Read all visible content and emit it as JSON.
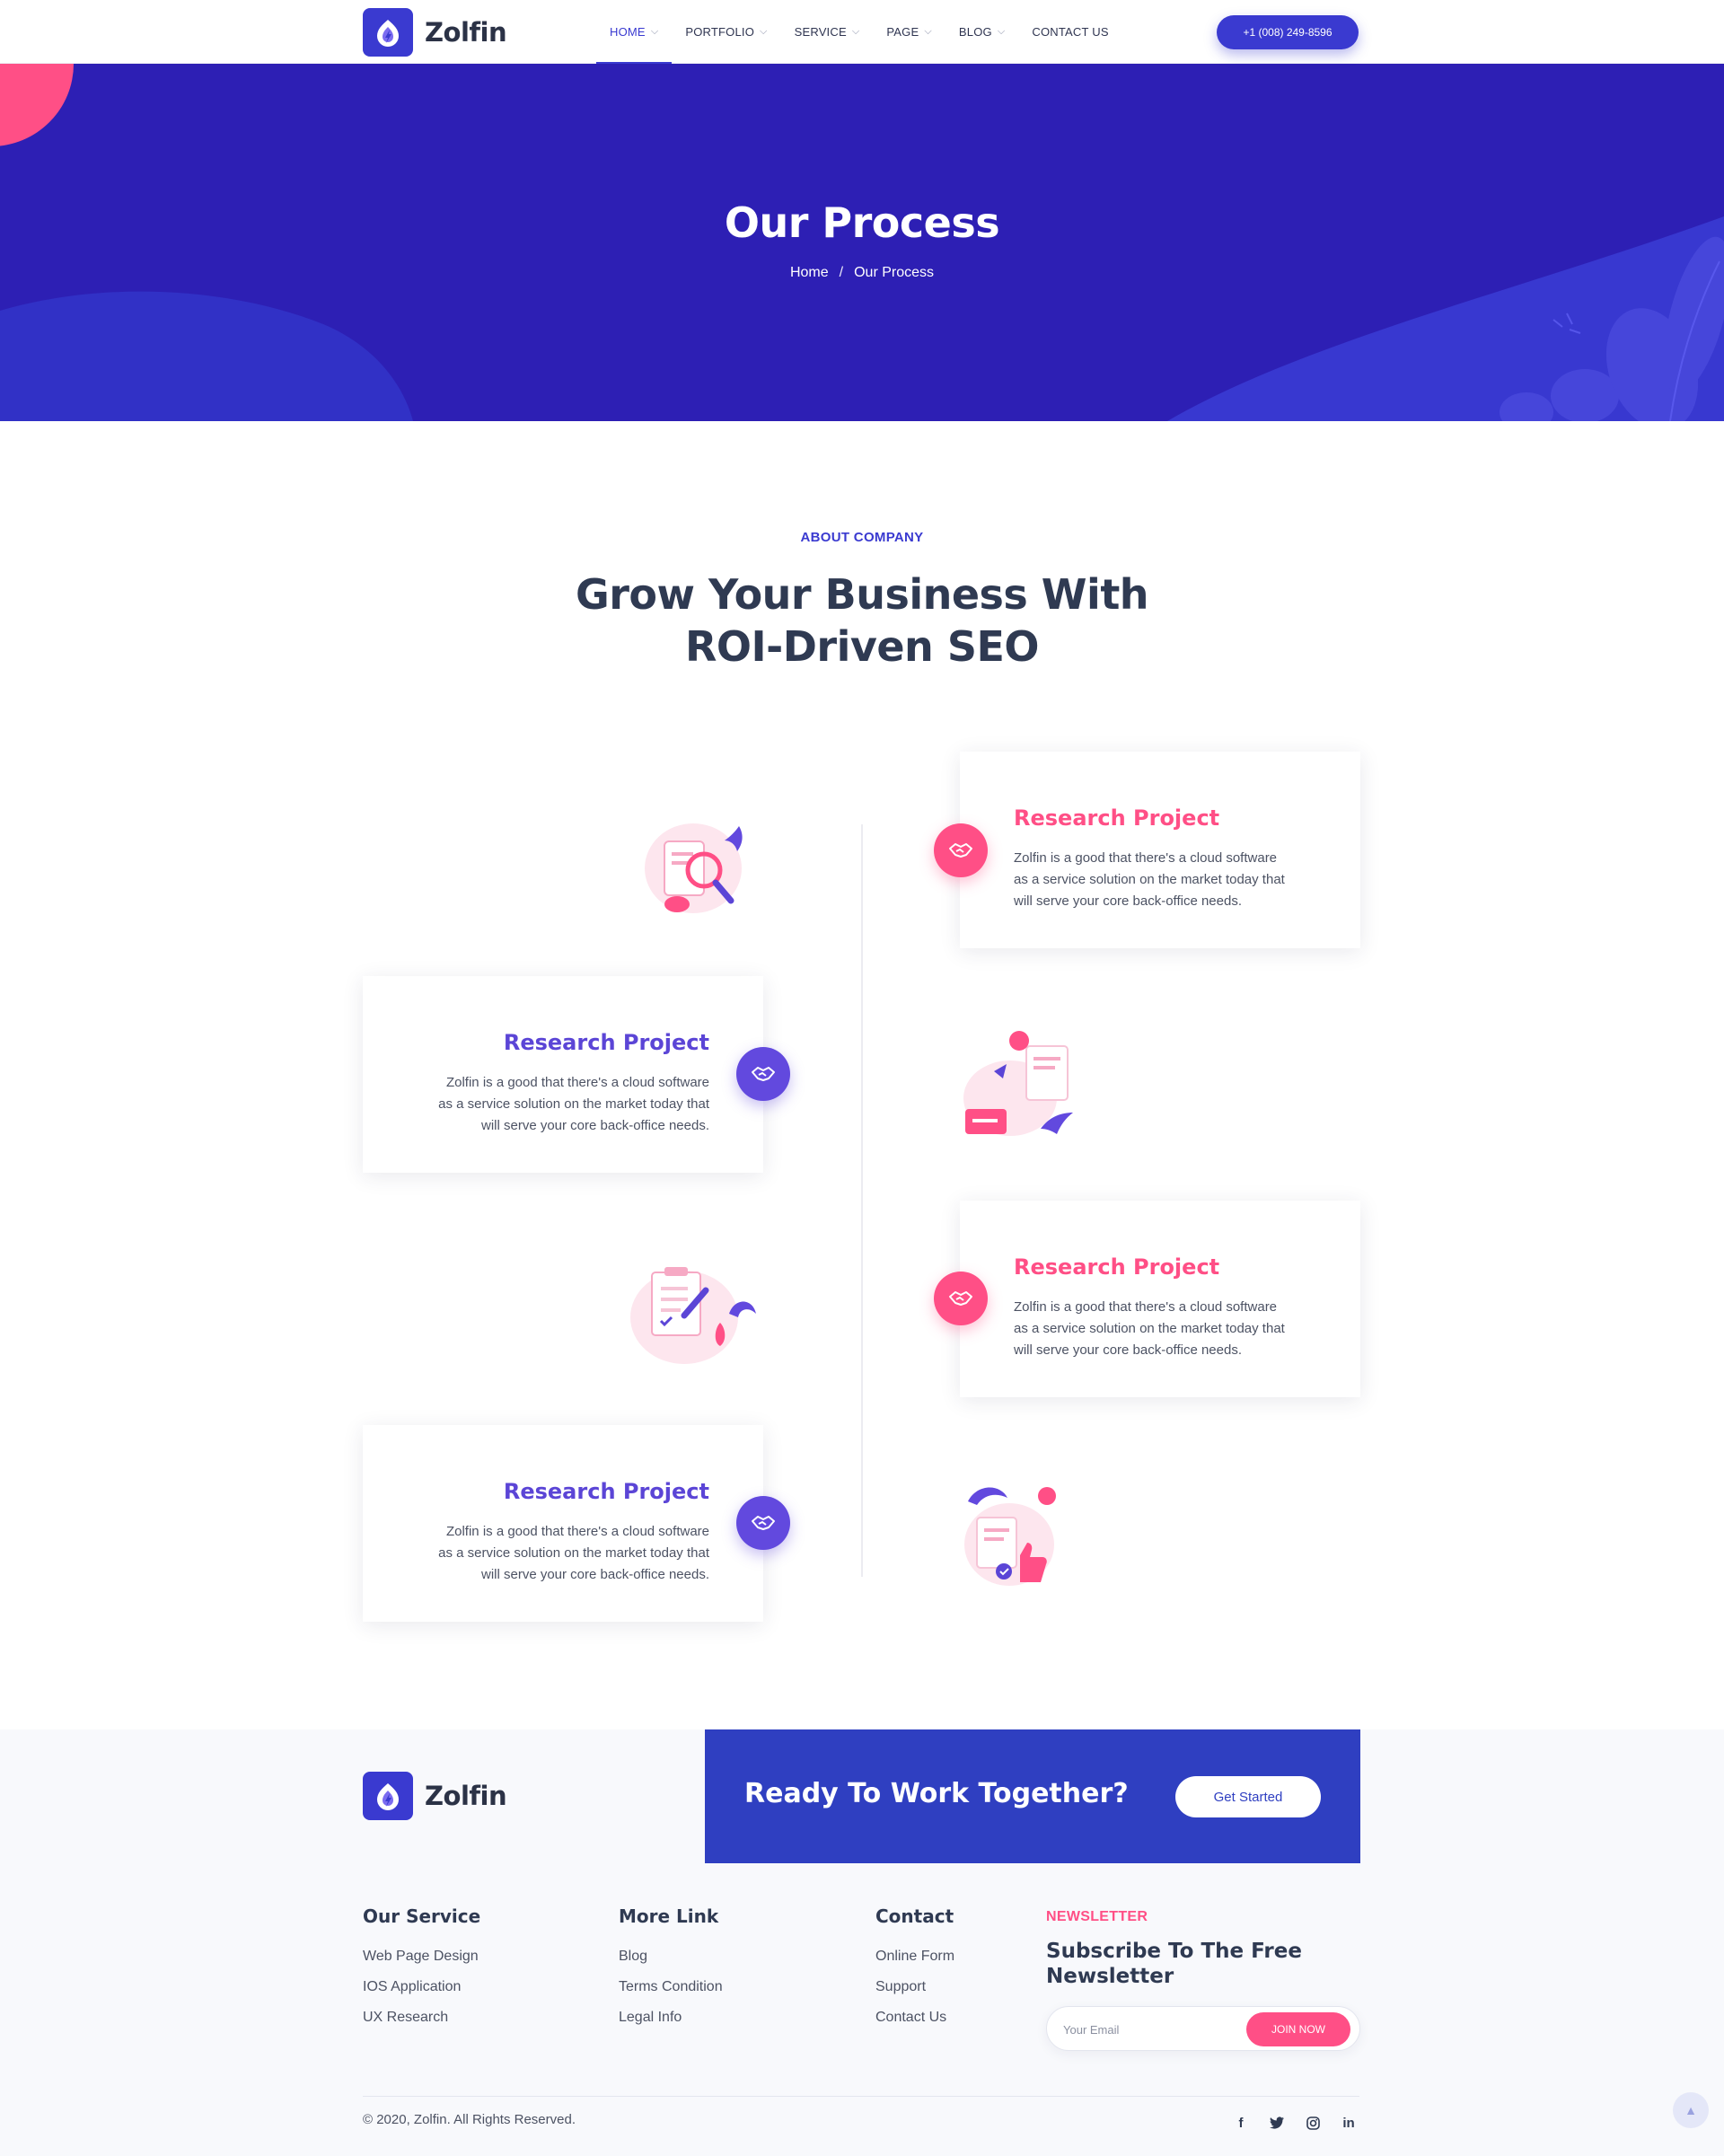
{
  "brand": {
    "name": "Zolfin"
  },
  "nav": {
    "items": [
      {
        "label": "HOME",
        "has_dropdown": true,
        "active": true
      },
      {
        "label": "PORTFOLIO",
        "has_dropdown": true
      },
      {
        "label": "SERVICE",
        "has_dropdown": true
      },
      {
        "label": "PAGE",
        "has_dropdown": true
      },
      {
        "label": "BLOG",
        "has_dropdown": true
      },
      {
        "label": "CONTACT US",
        "has_dropdown": false
      }
    ],
    "phone_button": "+1 (008) 249-8596"
  },
  "banner": {
    "title": "Our Process",
    "breadcrumb": {
      "home": "Home",
      "separator": "/",
      "current": "Our Process"
    }
  },
  "about": {
    "eyebrow": "ABOUT COMPANY",
    "title_line1": "Grow Your Business With",
    "title_line2": "ROI-Driven SEO"
  },
  "process": {
    "steps": [
      {
        "title": "Research Project",
        "line1": "Zolfin is a good that there's a cloud software",
        "line2": "as a service solution on the market today that",
        "line3": "will serve your core back-office needs.",
        "side": "right",
        "icon": "handshake-icon",
        "illustration": "search-document-illustration"
      },
      {
        "title": "Research Project",
        "line1": "Zolfin is a good that there's a cloud software",
        "line2": "as a service solution on the market today that",
        "line3": "will serve your core back-office needs.",
        "side": "left",
        "icon": "handshake-icon",
        "illustration": "chat-messages-illustration"
      },
      {
        "title": "Research Project",
        "line1": "Zolfin is a good that there's a cloud software",
        "line2": "as a service solution on the market today that",
        "line3": "will serve your core back-office needs.",
        "side": "right",
        "icon": "handshake-icon",
        "illustration": "clipboard-checklist-illustration"
      },
      {
        "title": "Research Project",
        "line1": "Zolfin is a good that there's a cloud software",
        "line2": "as a service solution on the market today that",
        "line3": "will serve your core back-office needs.",
        "side": "left",
        "icon": "handshake-icon",
        "illustration": "thumbs-up-document-illustration"
      }
    ]
  },
  "cta": {
    "title": "Ready To Work Together?",
    "button": "Get Started"
  },
  "footer": {
    "columns": [
      {
        "heading": "Our Service",
        "links": [
          "Web Page Design",
          "IOS Application",
          "UX Research"
        ]
      },
      {
        "heading": "More Link",
        "links": [
          "Blog",
          "Terms Condition",
          "Legal Info"
        ]
      },
      {
        "heading": "Contact",
        "links": [
          "Online Form",
          "Support",
          "Contact Us"
        ]
      }
    ],
    "newsletter": {
      "eyebrow": "NEWSLETTER",
      "title": "Subscribe To The Free Newsletter",
      "placeholder": "Your Email",
      "button": "JOIN NOW"
    },
    "copyright": "© 2020, Zolfin. All Rights Reserved.",
    "socials": [
      {
        "icon": "facebook-icon",
        "glyph": "f"
      },
      {
        "icon": "twitter-icon",
        "glyph": "t"
      },
      {
        "icon": "instagram-icon",
        "glyph": "◎"
      },
      {
        "icon": "linkedin-icon",
        "glyph": "in"
      }
    ]
  },
  "colors": {
    "primary": "#3a3ad0",
    "banner": "#2d1fb4",
    "accent_pink": "#ff4f86",
    "accent_purple": "#6249de",
    "cta": "#2f3fc1"
  }
}
